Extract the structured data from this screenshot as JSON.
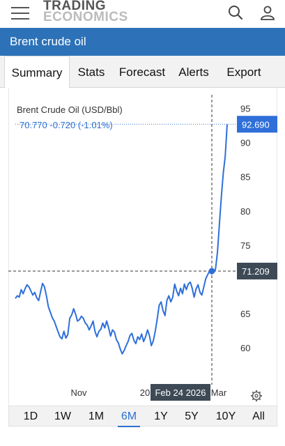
{
  "header": {
    "logo_line1": "TRADING",
    "logo_line2": "ECONOMICS"
  },
  "title": "Brent crude oil",
  "tabs": [
    {
      "label": "Summary",
      "active": true
    },
    {
      "label": "Stats"
    },
    {
      "label": "Forecast"
    },
    {
      "label": "Alerts"
    },
    {
      "label": "Export"
    }
  ],
  "quote": {
    "name": "Brent Crude Oil (USD/Bbl)",
    "price": "70.770",
    "change": "-0.720",
    "change_pct": "(-1.01%)"
  },
  "chart_data": {
    "type": "line",
    "x_tick_labels": [
      "Nov",
      "20",
      "Mar"
    ],
    "y_ticks": [
      60,
      65,
      70,
      75,
      80,
      85,
      90,
      95
    ],
    "y_tick_labels": [
      "60",
      "65",
      "75",
      "80",
      "85",
      "90",
      "95"
    ],
    "ylim": [
      55,
      97
    ],
    "series": [
      {
        "values": [
          67.2,
          67.6,
          67.4,
          68.5,
          67.9,
          68.6,
          69.2,
          68.9,
          68.3,
          67.7,
          68.1,
          67.3,
          66.9,
          68.2,
          69.4,
          68.9,
          67.6,
          66.0,
          65.2,
          64.4,
          63.9,
          63.1,
          62.3,
          61.6,
          61.3,
          62.4,
          61.4,
          61.9,
          64.3,
          64.8,
          65.7,
          64.9,
          63.9,
          64.1,
          64.6,
          64.3,
          63.6,
          63.3,
          62.6,
          63.2,
          63.9,
          62.4,
          61.6,
          62.4,
          62.7,
          63.6,
          62.9,
          63.9,
          62.9,
          61.7,
          62.6,
          62.3,
          61.2,
          60.7,
          59.8,
          59.1,
          59.6,
          60.3,
          60.9,
          61.8,
          62.1,
          61.1,
          60.6,
          61.6,
          61.2,
          62.0,
          60.9,
          61.6,
          62.6,
          61.8,
          60.3,
          61.0,
          62.4,
          64.2,
          66.2,
          66.7,
          65.4,
          64.7,
          66.9,
          67.6,
          66.7,
          67.4,
          69.3,
          68.3,
          67.6,
          68.7,
          67.9,
          69.3,
          68.5,
          69.3,
          69.6,
          68.7,
          67.4,
          68.6,
          69.2,
          68.1,
          67.7,
          68.9,
          70.1,
          70.7,
          71.2,
          70.8,
          71.0,
          71.5,
          74.0,
          78.0,
          82.0,
          85.5,
          88.0,
          92.69
        ]
      }
    ],
    "crosshair_date": "Feb 24 2026",
    "crosshair_value": "71.209",
    "last_value": "92.690",
    "colors": {
      "line": "#2e6fd9",
      "label_bg": "#2e6fd9",
      "crosshair_label_bg": "#3d4a56"
    }
  },
  "ranges": [
    {
      "label": "1D"
    },
    {
      "label": "1W"
    },
    {
      "label": "1M"
    },
    {
      "label": "6M",
      "active": true
    },
    {
      "label": "1Y"
    },
    {
      "label": "5Y"
    },
    {
      "label": "10Y"
    },
    {
      "label": "All"
    }
  ],
  "icons": {
    "menu": "hamburger-icon",
    "search": "search-icon",
    "user": "user-icon",
    "settings": "gear-icon"
  }
}
